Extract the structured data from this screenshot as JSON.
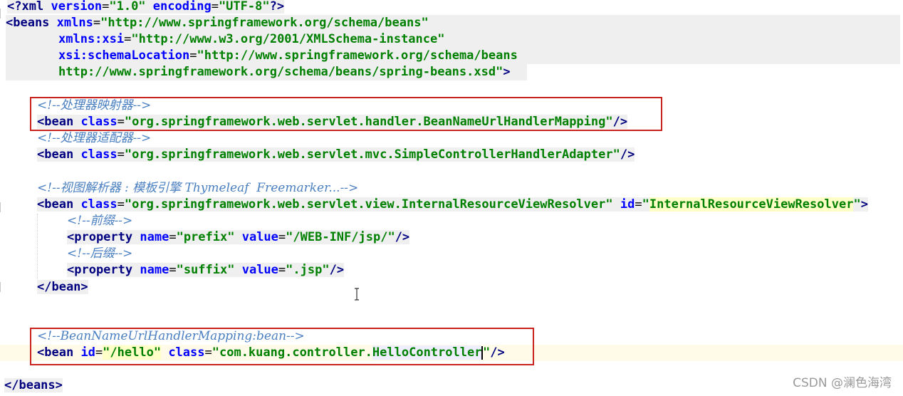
{
  "editor": {
    "xml_decl": {
      "open": "<?",
      "name": "xml",
      "version_attr": "version",
      "version_val": "\"1.0\"",
      "encoding_attr": "encoding",
      "encoding_val": "\"UTF-8\"",
      "close": "?>"
    },
    "beans_open": {
      "tag": "<beans",
      "xmlns_attr": "xmlns",
      "xmlns_val": "\"http://www.springframework.org/schema/beans\"",
      "xsi_attr": "xmlns:xsi",
      "xsi_val": "\"http://www.w3.org/2001/XMLSchema-instance\"",
      "schema_attr": "xsi:schemaLocation",
      "schema_val1": "\"http://www.springframework.org/schema/beans",
      "schema_val2": "http://www.springframework.org/schema/beans/spring-beans.xsd\"",
      "close": ">"
    },
    "comment_mapping": "<!--处理器映射器-->",
    "bean_mapping": {
      "open": "<bean",
      "attr": "class",
      "val": "\"org.springframework.web.servlet.handler.BeanNameUrlHandlerMapping\"",
      "close": "/>"
    },
    "comment_adapter": "<!--处理器适配器-->",
    "bean_adapter": {
      "open": "<bean",
      "attr": "class",
      "val": "\"org.springframework.web.servlet.mvc.SimpleControllerHandlerAdapter\"",
      "close": "/>"
    },
    "comment_resolver": "<!--视图解析器 : 模板引擎 Thymeleaf  Freemarker...-->",
    "bean_resolver": {
      "open": "<bean",
      "class_attr": "class",
      "class_val": "\"org.springframework.web.servlet.view.InternalResourceViewResolver\"",
      "id_attr": "id",
      "id_q1": "\"",
      "id_val": "InternalResourceViewResolver",
      "id_q2": "\"",
      "close": ">"
    },
    "comment_prefix": "<!--前缀-->",
    "prop_prefix": {
      "open": "<property",
      "name_attr": "name",
      "name_val": "\"prefix\"",
      "value_attr": "value",
      "value_val": "\"/WEB-INF/jsp/\"",
      "close": "/>"
    },
    "comment_suffix": "<!--后缀-->",
    "prop_suffix": {
      "open": "<property",
      "name_attr": "name",
      "name_val": "\"suffix\"",
      "value_attr": "value",
      "value_val": "\".jsp\"",
      "close": "/>"
    },
    "bean_close": "</bean>",
    "comment_hello": "<!--BeanNameUrlHandlerMapping:bean-->",
    "bean_hello": {
      "open": "<bean",
      "id_attr": "id",
      "id_val": "\"/hello\"",
      "class_attr": "class",
      "class_val_pre": "\"com.kuang.controller.",
      "class_val_hl": "HelloControlle",
      "class_val_tail": "r",
      "class_val_post": "\"",
      "close": "/>"
    },
    "beans_close": "</beans>"
  },
  "watermark": "CSDN @澜色海湾",
  "colors": {
    "tag": "#000080",
    "attr": "#0000ff",
    "value": "#008000",
    "comment": "#4a7fc0",
    "highlight_box": "#c8231c"
  }
}
